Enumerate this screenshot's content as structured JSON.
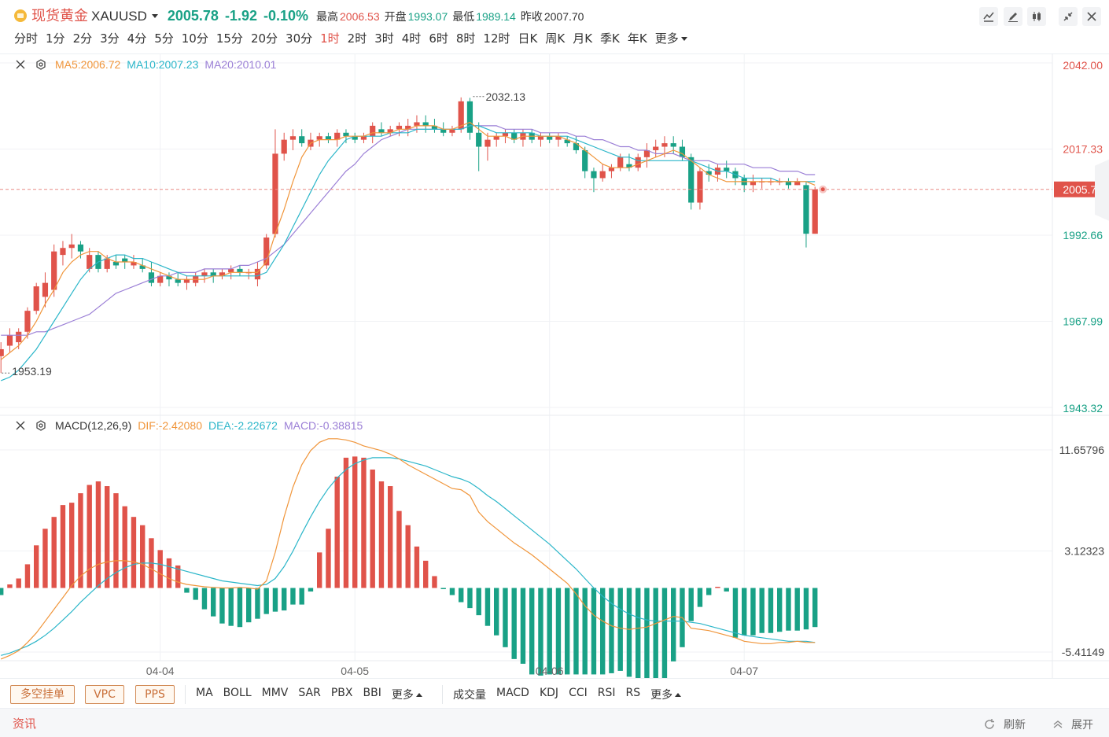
{
  "header": {
    "name": "现货黄金",
    "code": "XAUUSD",
    "price": "2005.78",
    "change": "-1.92",
    "change_pct": "-0.10%",
    "high_label": "最高",
    "high": "2006.53",
    "open_label": "开盘",
    "open": "1993.07",
    "low_label": "最低",
    "low": "1989.14",
    "prev_label": "昨收",
    "prev": "2007.70"
  },
  "toolbar": {
    "icons": [
      "line-chart-icon",
      "draw-pen-icon",
      "candle-style-icon",
      "collapse-icon",
      "close-icon"
    ]
  },
  "periods": {
    "items": [
      "分时",
      "1分",
      "2分",
      "3分",
      "4分",
      "5分",
      "10分",
      "15分",
      "20分",
      "30分",
      "1时",
      "2时",
      "3时",
      "4时",
      "6时",
      "8时",
      "12时",
      "日K",
      "周K",
      "月K",
      "季K",
      "年K",
      "更多"
    ],
    "active": "1时"
  },
  "main_legend": {
    "ma5": "MA5:2006.72",
    "ma10": "MA10:2007.23",
    "ma20": "MA20:2010.01"
  },
  "macd_legend": {
    "name": "MACD(12,26,9)",
    "dif": "DIF:-2.42080",
    "dea": "DEA:-2.22672",
    "macd": "MACD:-0.38815"
  },
  "colors": {
    "up": "#e0534a",
    "down": "#19a186",
    "ma5": "#f0953a",
    "ma10": "#2bb6c9",
    "ma20": "#9b7fd6",
    "accent": "#e0534a"
  },
  "chart_data": [
    {
      "type": "candlestick",
      "title": "XAUUSD 1时",
      "y_ticks": [
        "2042.00",
        "2017.33",
        "1992.66",
        "1967.99",
        "1943.32"
      ],
      "ylim": [
        1943.32,
        2042.0
      ],
      "x_tick_labels": [
        {
          "label": "04-04",
          "index": 18
        },
        {
          "label": "04-05",
          "index": 40
        },
        {
          "label": "04-06",
          "index": 62
        },
        {
          "label": "04-07",
          "index": 84
        }
      ],
      "current_price": "2005.78",
      "annotations": [
        {
          "text": "2032.13",
          "index": 53,
          "value": 2032.13
        },
        {
          "text": "1953.19",
          "index": 0,
          "value": 1953.19
        }
      ],
      "ohlc": [
        [
          1958,
          1962,
          1953.19,
          1960
        ],
        [
          1961,
          1966,
          1959,
          1964
        ],
        [
          1962,
          1966,
          1960,
          1965
        ],
        [
          1965,
          1972,
          1963,
          1971
        ],
        [
          1971,
          1979,
          1970,
          1978
        ],
        [
          1975,
          1982,
          1972,
          1979
        ],
        [
          1977,
          1990,
          1975,
          1988
        ],
        [
          1987,
          1991,
          1984,
          1989
        ],
        [
          1989,
          1993,
          1986,
          1990
        ],
        [
          1990,
          1991,
          1986,
          1988
        ],
        [
          1983,
          1989,
          1982,
          1987
        ],
        [
          1987,
          1988,
          1982,
          1983
        ],
        [
          1983,
          1987,
          1982,
          1986
        ],
        [
          1985,
          1987,
          1983,
          1984
        ],
        [
          1986,
          1987,
          1983,
          1985
        ],
        [
          1984,
          1987,
          1983,
          1985
        ],
        [
          1984,
          1986,
          1982,
          1983
        ],
        [
          1982,
          1985,
          1978,
          1979
        ],
        [
          1979,
          1982,
          1978,
          1981
        ],
        [
          1981,
          1982,
          1978,
          1980
        ],
        [
          1980,
          1982,
          1978,
          1979
        ],
        [
          1979,
          1981,
          1977,
          1980
        ],
        [
          1979,
          1982,
          1978,
          1981
        ],
        [
          1981,
          1983,
          1979,
          1982
        ],
        [
          1982,
          1983,
          1979,
          1981
        ],
        [
          1981,
          1983,
          1980,
          1982
        ],
        [
          1982,
          1984,
          1980,
          1983
        ],
        [
          1983,
          1984,
          1981,
          1982
        ],
        [
          1982,
          1983,
          1980,
          1982
        ],
        [
          1980,
          1985,
          1978,
          1983
        ],
        [
          1984,
          1993,
          1983,
          1992
        ],
        [
          1993,
          2023,
          1992,
          2016
        ],
        [
          2016,
          2022,
          2014,
          2020
        ],
        [
          2020,
          2023,
          2017,
          2021
        ],
        [
          2021,
          2023,
          2018,
          2019
        ],
        [
          2018,
          2022,
          2017,
          2020
        ],
        [
          2020,
          2022,
          2018,
          2021
        ],
        [
          2021,
          2022,
          2019,
          2020
        ],
        [
          2020,
          2023,
          2018,
          2022
        ],
        [
          2022,
          2023,
          2019,
          2021
        ],
        [
          2021,
          2022,
          2019,
          2020
        ],
        [
          2020,
          2022,
          2019,
          2021
        ],
        [
          2021,
          2025,
          2019,
          2024
        ],
        [
          2023,
          2025,
          2021,
          2022
        ],
        [
          2022,
          2024,
          2021,
          2023
        ],
        [
          2023,
          2025,
          2021,
          2024
        ],
        [
          2023,
          2026,
          2021,
          2024
        ],
        [
          2024,
          2027,
          2022,
          2025
        ],
        [
          2025,
          2027,
          2022,
          2024
        ],
        [
          2024,
          2026,
          2022,
          2023
        ],
        [
          2023,
          2025,
          2021,
          2022
        ],
        [
          2022,
          2024,
          2021,
          2023
        ],
        [
          2023,
          2032.13,
          2022,
          2031
        ],
        [
          2031,
          2032,
          2020,
          2022
        ],
        [
          2022,
          2025,
          2011,
          2018
        ],
        [
          2018,
          2022,
          2014,
          2020
        ],
        [
          2020,
          2022,
          2018,
          2021
        ],
        [
          2021,
          2023,
          2019,
          2022
        ],
        [
          2022,
          2023,
          2019,
          2020
        ],
        [
          2020,
          2023,
          2018,
          2022
        ],
        [
          2022,
          2023,
          2019,
          2020
        ],
        [
          2020,
          2022,
          2018,
          2021
        ],
        [
          2021,
          2022,
          2019,
          2020
        ],
        [
          2020,
          2022,
          2018,
          2021
        ],
        [
          2020,
          2021,
          2018,
          2019
        ],
        [
          2019,
          2021,
          2016,
          2017
        ],
        [
          2017,
          2018,
          2009,
          2011
        ],
        [
          2011,
          2012,
          2005,
          2009
        ],
        [
          2009,
          2013,
          2008,
          2011
        ],
        [
          2011,
          2013,
          2009,
          2012
        ],
        [
          2012,
          2016,
          2011,
          2015
        ],
        [
          2013,
          2016,
          2011,
          2012
        ],
        [
          2012,
          2016,
          2011,
          2015
        ],
        [
          2015,
          2019,
          2012,
          2017
        ],
        [
          2017,
          2020,
          2015,
          2018
        ],
        [
          2018,
          2021,
          2015,
          2019
        ],
        [
          2019,
          2021,
          2016,
          2018
        ],
        [
          2018,
          2020,
          2014,
          2015
        ],
        [
          2015,
          2016,
          2000,
          2002
        ],
        [
          2002,
          2012,
          2000,
          2011
        ],
        [
          2011,
          2013,
          2008,
          2010
        ],
        [
          2010,
          2013,
          2008,
          2012
        ],
        [
          2012,
          2014,
          2009,
          2011
        ],
        [
          2011,
          2012,
          2007,
          2009
        ],
        [
          2009,
          2010,
          2005,
          2007
        ],
        [
          2007,
          2010,
          2005,
          2008
        ],
        [
          2008,
          2009,
          2006,
          2008
        ],
        [
          2008,
          2009,
          2007,
          2008
        ],
        [
          2008,
          2009,
          2007,
          2008
        ],
        [
          2008,
          2009,
          2006,
          2007
        ],
        [
          2007,
          2009,
          2007,
          2008
        ],
        [
          2007,
          2008,
          1989.14,
          1993.07
        ],
        [
          1993.07,
          2006.53,
          1993.07,
          2005.78
        ]
      ],
      "ma5": [
        1957,
        1959,
        1961,
        1964,
        1968,
        1973,
        1977,
        1982,
        1985,
        1987,
        1988,
        1988,
        1986,
        1985,
        1985,
        1985,
        1984,
        1983,
        1982,
        1981,
        1980,
        1980,
        1980,
        1980,
        1981,
        1981,
        1982,
        1982,
        1982,
        1982,
        1985,
        1993,
        2000,
        2008,
        2015,
        2019,
        2020,
        2020,
        2020,
        2021,
        2021,
        2021,
        2022,
        2022,
        2022,
        2023,
        2023,
        2024,
        2024,
        2024,
        2023,
        2023,
        2024,
        2025,
        2023,
        2021,
        2021,
        2021,
        2020,
        2021,
        2021,
        2021,
        2021,
        2021,
        2020,
        2019,
        2017,
        2015,
        2013,
        2012,
        2012,
        2012,
        2013,
        2014,
        2015,
        2016,
        2017,
        2016,
        2014,
        2012,
        2010,
        2009,
        2008,
        2008,
        2008,
        2008,
        2008,
        2008,
        2008,
        2008,
        2008,
        2008,
        2007
      ],
      "ma10": [
        1951,
        1952,
        1954,
        1957,
        1960,
        1964,
        1968,
        1972,
        1976,
        1980,
        1983,
        1985,
        1986,
        1987,
        1987,
        1986,
        1986,
        1985,
        1984,
        1983,
        1982,
        1981,
        1981,
        1981,
        1981,
        1981,
        1981,
        1981,
        1981,
        1981,
        1982,
        1986,
        1990,
        1995,
        2000,
        2005,
        2010,
        2014,
        2017,
        2020,
        2021,
        2021,
        2021,
        2021,
        2022,
        2022,
        2022,
        2023,
        2023,
        2023,
        2023,
        2023,
        2023,
        2024,
        2024,
        2023,
        2022,
        2022,
        2022,
        2022,
        2022,
        2021,
        2021,
        2021,
        2021,
        2020,
        2019,
        2018,
        2017,
        2016,
        2015,
        2015,
        2014,
        2014,
        2014,
        2014,
        2014,
        2014,
        2014,
        2013,
        2012,
        2011,
        2011,
        2010,
        2009,
        2009,
        2009,
        2009,
        2008,
        2008,
        2008,
        2008,
        2008
      ],
      "ma20": [
        1964,
        1964,
        1964,
        1964,
        1965,
        1965,
        1966,
        1967,
        1968,
        1969,
        1970,
        1972,
        1974,
        1976,
        1977,
        1978,
        1979,
        1980,
        1981,
        1981,
        1982,
        1982,
        1982,
        1983,
        1983,
        1983,
        1983,
        1984,
        1984,
        1985,
        1986,
        1988,
        1990,
        1993,
        1996,
        1999,
        2002,
        2005,
        2008,
        2011,
        2013,
        2016,
        2018,
        2020,
        2021,
        2022,
        2023,
        2023,
        2023,
        2023,
        2023,
        2023,
        2023,
        2024,
        2024,
        2024,
        2024,
        2023,
        2023,
        2023,
        2023,
        2022,
        2022,
        2022,
        2022,
        2021,
        2021,
        2020,
        2020,
        2019,
        2018,
        2018,
        2017,
        2017,
        2016,
        2016,
        2016,
        2015,
        2014,
        2014,
        2014,
        2013,
        2013,
        2013,
        2013,
        2012,
        2012,
        2012,
        2011,
        2011,
        2011,
        2010,
        2010
      ]
    },
    {
      "type": "macd",
      "y_ticks": [
        "11.65796",
        "3.12323",
        "-5.41149"
      ],
      "ylim": [
        -5.41149,
        11.65796
      ],
      "dif": [
        -6.0,
        -5.7,
        -5.3,
        -4.6,
        -3.8,
        -2.8,
        -1.8,
        -0.8,
        0.2,
        1.0,
        1.6,
        2.0,
        2.2,
        2.3,
        2.3,
        2.2,
        2.0,
        1.6,
        1.2,
        0.8,
        0.5,
        0.3,
        0.2,
        0.1,
        0.05,
        0.0,
        0.0,
        0.05,
        0.0,
        -0.1,
        0.6,
        3.0,
        6.0,
        8.5,
        10.4,
        11.6,
        12.3,
        12.6,
        12.6,
        12.5,
        12.3,
        12.0,
        11.8,
        11.6,
        11.3,
        10.9,
        10.4,
        10.0,
        9.6,
        9.2,
        8.8,
        8.4,
        8.3,
        7.8,
        6.4,
        5.6,
        5.0,
        4.4,
        3.8,
        3.3,
        2.8,
        2.2,
        1.6,
        1.0,
        0.4,
        -0.5,
        -1.5,
        -2.3,
        -2.8,
        -3.2,
        -3.4,
        -3.5,
        -3.4,
        -3.3,
        -3.0,
        -2.7,
        -2.4,
        -2.5,
        -3.4,
        -3.5,
        -3.6,
        -3.8,
        -4.0,
        -4.2,
        -4.5,
        -4.6,
        -4.7,
        -4.7,
        -4.6,
        -4.6,
        -4.5,
        -4.6,
        -4.6
      ],
      "dea": [
        -5.7,
        -5.5,
        -5.2,
        -4.9,
        -4.5,
        -4.0,
        -3.4,
        -2.7,
        -2.0,
        -1.2,
        -0.5,
        0.2,
        0.8,
        1.3,
        1.7,
        2.0,
        2.1,
        2.1,
        2.0,
        1.8,
        1.6,
        1.4,
        1.2,
        1.0,
        0.8,
        0.6,
        0.5,
        0.4,
        0.3,
        0.2,
        0.3,
        0.8,
        1.8,
        3.1,
        4.6,
        6.0,
        7.3,
        8.4,
        9.3,
        10.0,
        10.5,
        10.8,
        11.0,
        11.0,
        11.0,
        10.9,
        10.7,
        10.5,
        10.3,
        10.0,
        9.7,
        9.4,
        9.2,
        8.9,
        8.4,
        7.8,
        7.3,
        6.7,
        6.1,
        5.5,
        4.9,
        4.3,
        3.7,
        3.0,
        2.3,
        1.6,
        0.8,
        0.0,
        -0.7,
        -1.3,
        -1.8,
        -2.2,
        -2.5,
        -2.7,
        -2.8,
        -2.8,
        -2.8,
        -2.8,
        -2.9,
        -3.0,
        -3.2,
        -3.4,
        -3.6,
        -3.8,
        -4.0,
        -4.1,
        -4.2,
        -4.3,
        -4.4,
        -4.5,
        -4.5,
        -4.5,
        -4.6
      ],
      "hist": [
        -0.6,
        0.3,
        0.8,
        2.0,
        3.6,
        5.0,
        6.0,
        7.0,
        7.2,
        8.0,
        8.7,
        9.0,
        8.6,
        8.0,
        6.9,
        6.0,
        5.3,
        4.2,
        3.2,
        2.5,
        1.9,
        -0.4,
        -1.0,
        -1.8,
        -2.4,
        -3.0,
        -3.2,
        -3.3,
        -2.9,
        -2.6,
        -2.2,
        -2.0,
        -1.9,
        -1.4,
        -1.4,
        -0.3,
        3.0,
        5.0,
        9.4,
        11.0,
        11.1,
        11.0,
        10.0,
        9.0,
        8.6,
        6.5,
        5.3,
        3.5,
        2.3,
        1.0,
        -0.1,
        -0.6,
        -1.2,
        -1.7,
        -2.3,
        -3.2,
        -4.0,
        -5.0,
        -6.0,
        -6.4,
        -7.3,
        -7.4,
        -7.3,
        -7.3,
        -7.3,
        -7.3,
        -7.3,
        -7.3,
        -7.3,
        -7.2,
        -7.0,
        -7.5,
        -8.3,
        -9.0,
        -9.3,
        -8.2,
        -6.2,
        -5.0,
        -2.8,
        -1.6,
        -0.6,
        0.1,
        -0.3,
        -4.2,
        -4.0,
        -4.0,
        -3.8,
        -3.8,
        -3.7,
        -3.6,
        -3.6,
        -3.5,
        -3.3
      ]
    }
  ],
  "bottom_bar": {
    "pills": [
      "多空挂单",
      "VPC",
      "PPS"
    ],
    "main_indicators": [
      "MA",
      "BOLL",
      "MMV",
      "SAR",
      "PBX",
      "BBI",
      "更多"
    ],
    "sub_indicators": [
      "成交量",
      "MACD",
      "KDJ",
      "CCI",
      "RSI",
      "RS",
      "更多"
    ]
  },
  "news": {
    "title": "资讯",
    "refresh": "刷新",
    "expand": "展开"
  }
}
